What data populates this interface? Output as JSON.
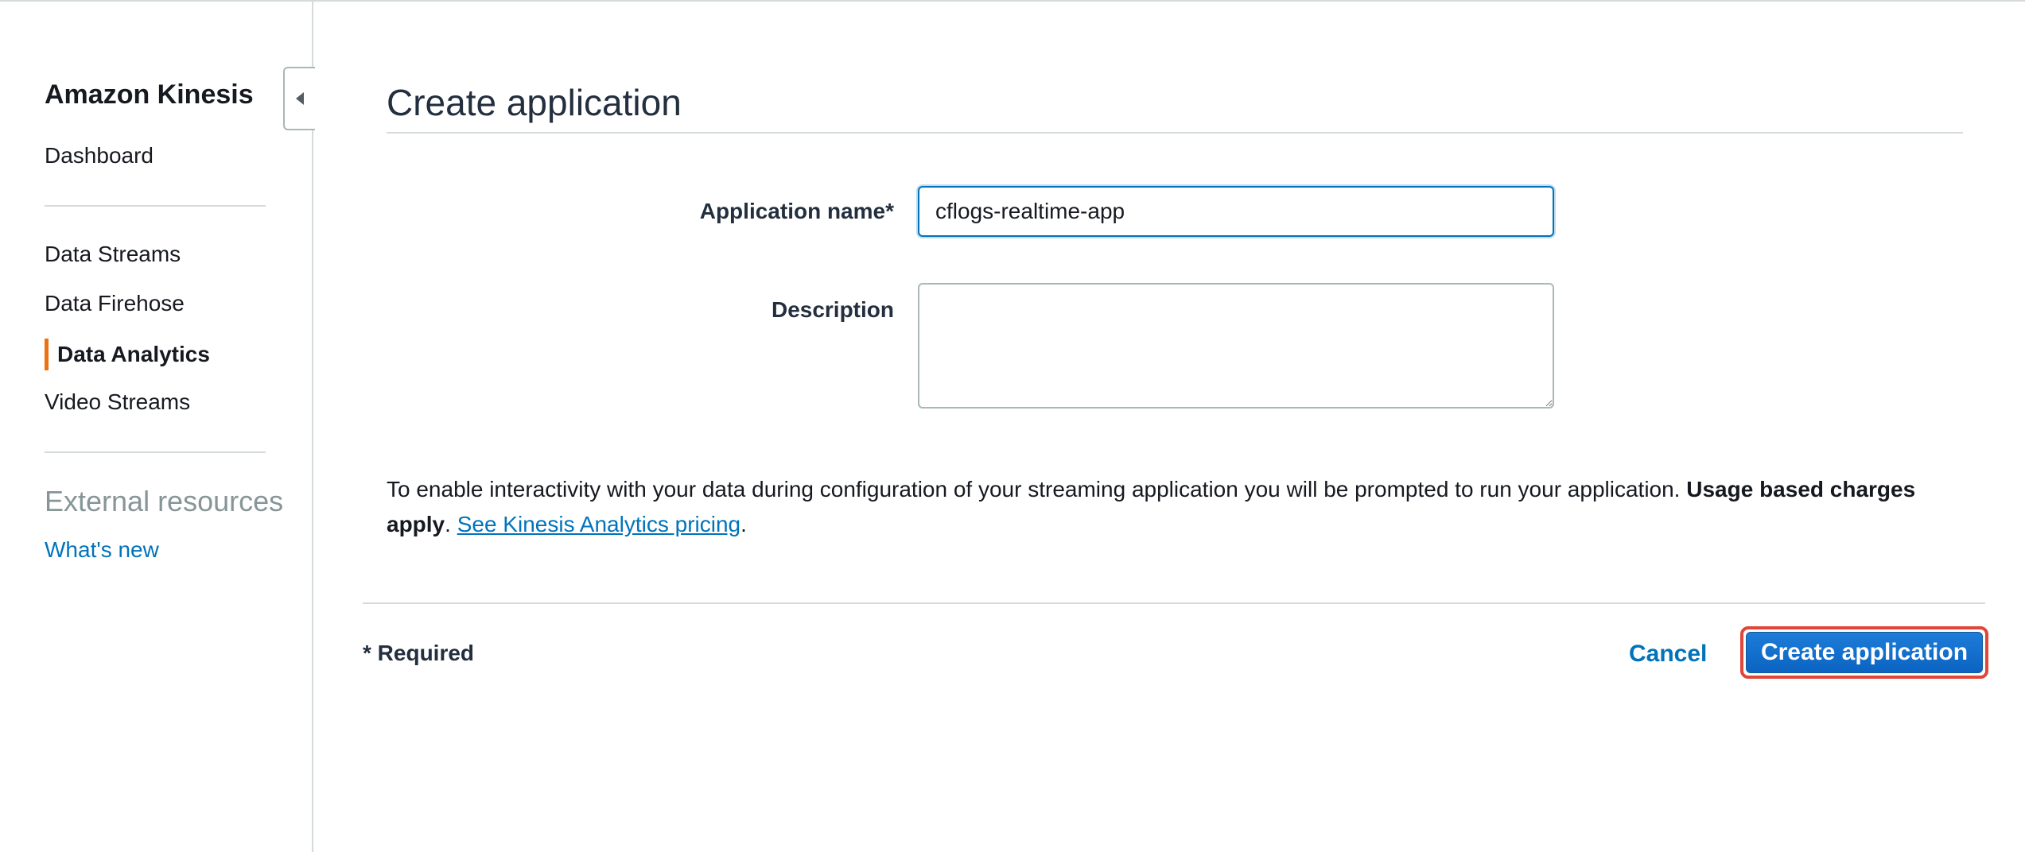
{
  "sidebar": {
    "title": "Amazon Kinesis",
    "items": [
      {
        "label": "Dashboard"
      },
      {
        "label": "Data Streams"
      },
      {
        "label": "Data Firehose"
      },
      {
        "label": "Data Analytics",
        "active": true
      },
      {
        "label": "Video Streams"
      }
    ],
    "section_title": "External resources",
    "links": [
      {
        "label": "What's new"
      }
    ]
  },
  "main": {
    "title": "Create application",
    "form": {
      "app_name_label": "Application name*",
      "app_name_value": "cflogs-realtime-app",
      "description_label": "Description",
      "description_value": ""
    },
    "info": {
      "text": "To enable interactivity with your data during configuration of your streaming application you will be prompted to run your application. ",
      "bold": "Usage based charges apply",
      "separator": ". ",
      "link": "See Kinesis Analytics pricing",
      "end": "."
    },
    "footer": {
      "required_note": "* Required",
      "cancel_label": "Cancel",
      "create_label": "Create application"
    }
  },
  "colors": {
    "accent_active": "#ec7211",
    "link": "#0073bb",
    "primary_button": "#0b63c2",
    "highlight_border": "#e0463a"
  },
  "icons": {
    "collapse": "caret-left-icon"
  }
}
